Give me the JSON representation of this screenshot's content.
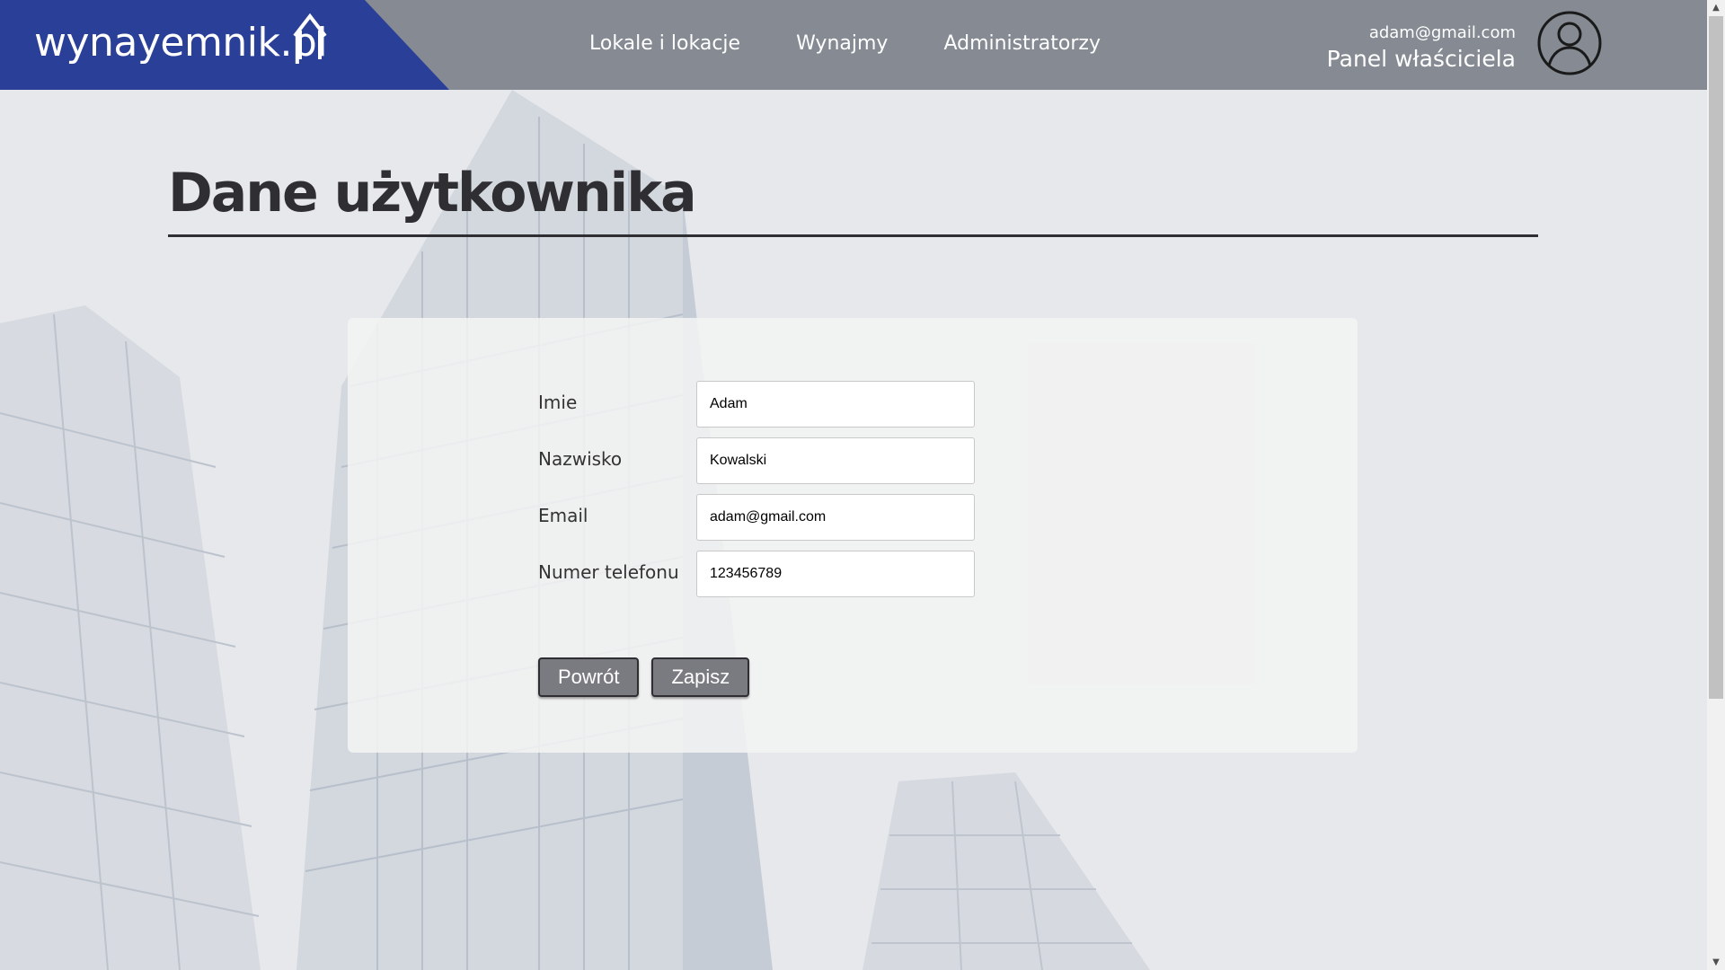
{
  "header": {
    "logo_text": "wynayemnik.pl",
    "nav": [
      {
        "label": "Lokale i lokacje"
      },
      {
        "label": "Wynajmy"
      },
      {
        "label": "Administratorzy"
      }
    ],
    "user_email": "adam@gmail.com",
    "user_role": "Panel właściciela",
    "colors": {
      "bar": "#858a93",
      "logo_block": "#2a3f97"
    }
  },
  "page": {
    "title": "Dane użytkownika"
  },
  "form": {
    "fields": [
      {
        "label": "Imie",
        "value": "Adam"
      },
      {
        "label": "Nazwisko",
        "value": "Kowalski"
      },
      {
        "label": "Email",
        "value": "adam@gmail.com"
      },
      {
        "label": "Numer telefonu",
        "value": "123456789"
      }
    ],
    "back_label": "Powrót",
    "save_label": "Zapisz"
  },
  "icons": {
    "avatar": "user-circle-icon",
    "logo_house": "house-outline-icon"
  }
}
